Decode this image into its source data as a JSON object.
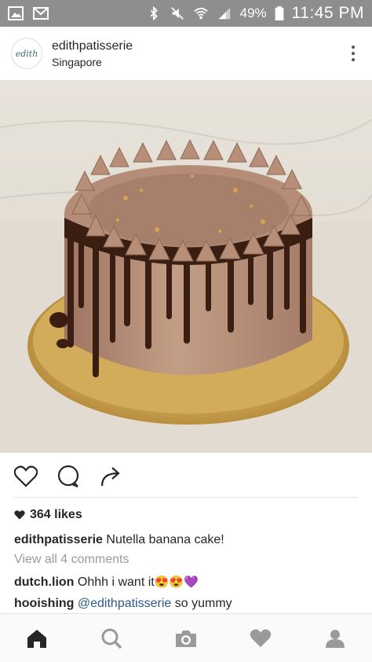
{
  "status_bar": {
    "battery_pct": "49%",
    "time": "11:45 PM",
    "icons": [
      "gallery-icon",
      "gmail-icon",
      "bluetooth-icon",
      "mute-icon",
      "wifi-icon",
      "signal-icon",
      "battery-icon"
    ]
  },
  "post": {
    "avatar_text": "edith",
    "username": "edithpatisserie",
    "location": "Singapore",
    "likes": "364 likes",
    "caption": {
      "user": "edithpatisserie",
      "text": "Nutella banana cake!"
    },
    "view_all": "View all 4 comments",
    "comments": [
      {
        "user": "dutch.lion",
        "text": "Ohhh i want it",
        "emoji": "😍😍💜"
      },
      {
        "user": "hooishing",
        "mention": "@edithpatisserie",
        "text": " so yummy"
      }
    ]
  },
  "colors": {
    "status_bar": "#8e8e8e",
    "link": "#2b5a8a",
    "muted": "#999999",
    "cake_frosting": "#b08a74",
    "chocolate": "#3a1e12",
    "cake_board": "#cfa954"
  },
  "nav": [
    "home-icon",
    "search-icon",
    "camera-icon",
    "heart-icon",
    "profile-icon"
  ]
}
